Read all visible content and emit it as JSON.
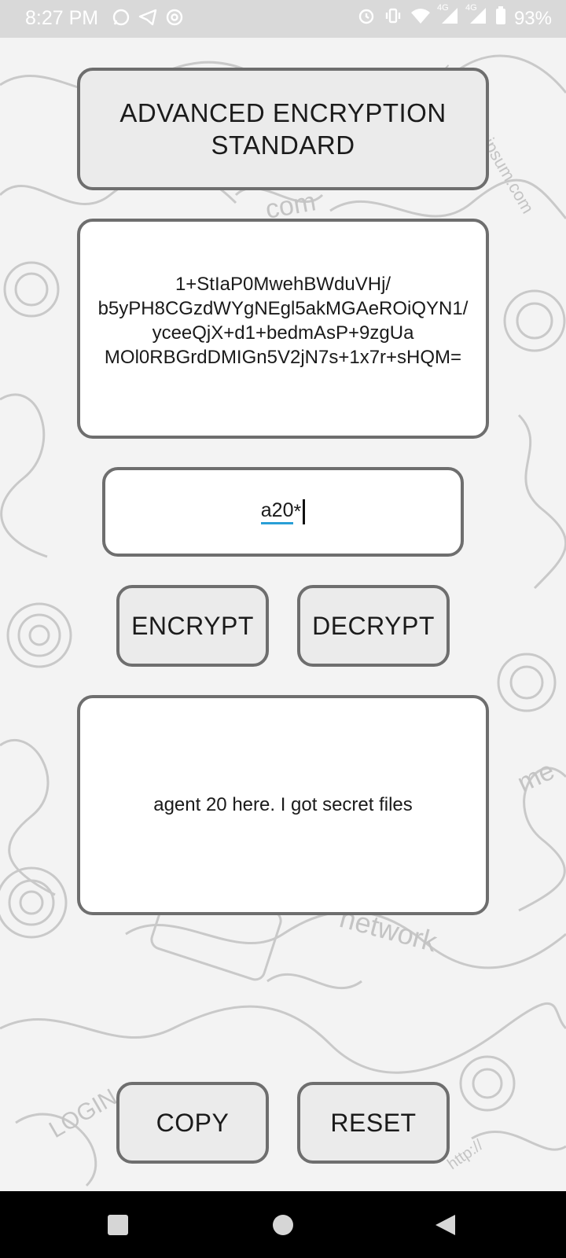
{
  "status_bar": {
    "time": "8:27 PM",
    "left_icons": [
      "whatsapp-icon",
      "telegram-icon",
      "sync-icon"
    ],
    "right_icons": [
      "alarm-icon",
      "vibrate-icon",
      "wifi-icon",
      "signal-4g-icon",
      "signal-4g-icon",
      "battery-icon"
    ],
    "network_labels": [
      "4G",
      "4G"
    ],
    "battery": "93%"
  },
  "title": {
    "text": "ADVANCED ENCRYPTION STANDARD"
  },
  "cipher_output": {
    "text": "1+StIaP0MwehBWduVHj/ b5yPH8CGzdWYgNEgl5akMGAeROiQYN1/ yceeQjX+d1+bedmAsP+9zgUa MOl0RBGrdDMIGn5V2jN7s+1x7r+sHQM="
  },
  "key_input": {
    "underlined_part": "a20",
    "trailing_part": "*"
  },
  "buttons": {
    "encrypt": "ENCRYPT",
    "decrypt": "DECRYPT",
    "copy": "COPY",
    "reset": "RESET"
  },
  "plain_text": {
    "text": "agent 20 here. I got secret files"
  },
  "nav_bar": {
    "icons": [
      "recents-square-icon",
      "home-circle-icon",
      "back-triangle-icon"
    ]
  },
  "background_doodle_words": [
    "www.loremipsum.com",
    "com",
    "LOGIN",
    "network",
    "me",
    "http://"
  ],
  "colors": {
    "panel_border": "#6e6e6e",
    "button_fill": "#ebebeb",
    "key_underline": "#2a9fd6",
    "status_bar": "#d9d9d9",
    "nav_bar": "#000000"
  }
}
